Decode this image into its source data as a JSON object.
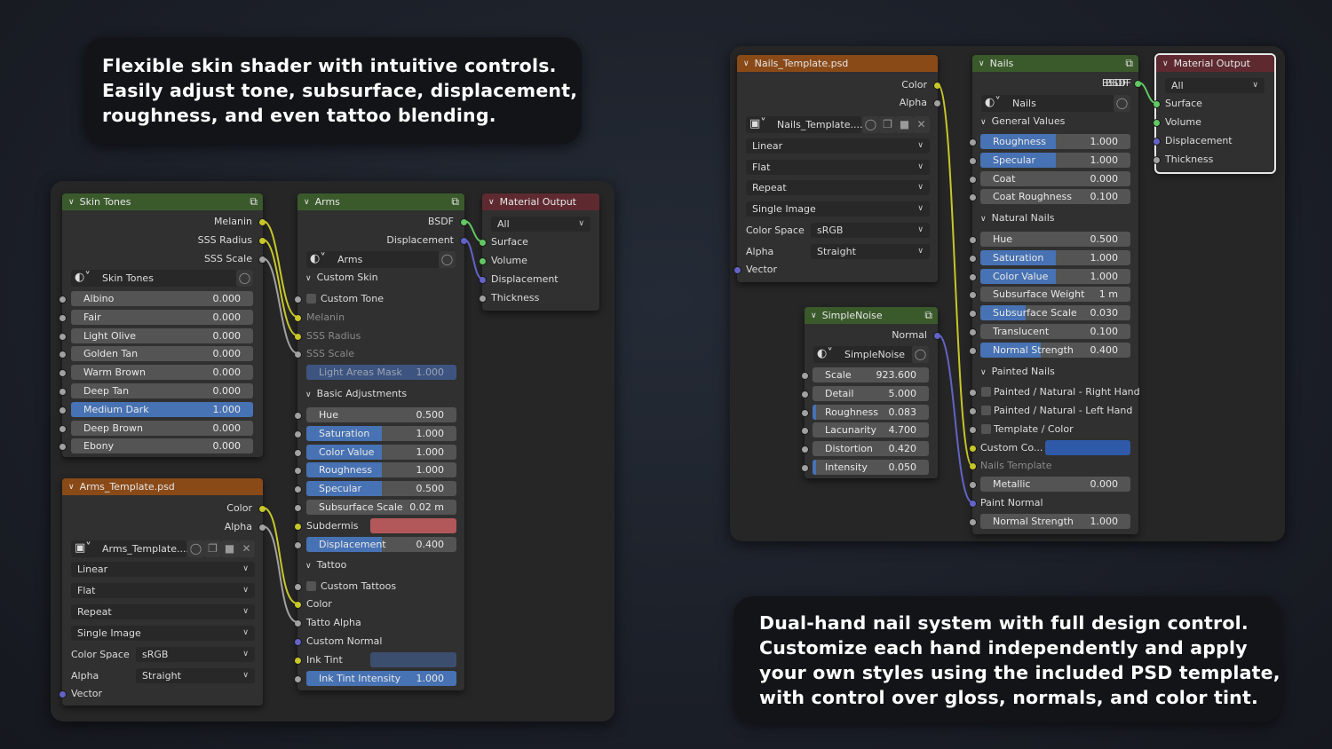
{
  "captions": {
    "top": [
      "Flexible skin shader with intuitive controls.",
      "Easily adjust tone, subsurface, displacement,",
      "roughness, and even tattoo blending."
    ],
    "bottom": [
      "Dual-hand nail system with full design control.",
      "Customize each hand independently and apply",
      "your own styles using the included PSD template,",
      "with control over gloss, normals, and color tint."
    ]
  },
  "colors": {
    "group_header": "#3b5a2c",
    "image_header": "#8a4a18",
    "output_header": "#5e2a30",
    "slider_fill": "#4772b3",
    "subdermis": "#b3585a",
    "ink_tint": "#3c4e6e",
    "custom_color": "#2f5aa8"
  },
  "skin_tones": {
    "title": "Skin Tones",
    "outputs": [
      "Melanin",
      "SSS Radius",
      "SSS Scale"
    ],
    "datablock": "Skin Tones",
    "sliders": [
      {
        "label": "Albino",
        "value": "0.000",
        "fill": 0
      },
      {
        "label": "Fair",
        "value": "0.000",
        "fill": 0
      },
      {
        "label": "Light Olive",
        "value": "0.000",
        "fill": 0
      },
      {
        "label": "Golden Tan",
        "value": "0.000",
        "fill": 0
      },
      {
        "label": "Warm Brown",
        "value": "0.000",
        "fill": 0
      },
      {
        "label": "Deep Tan",
        "value": "0.000",
        "fill": 0
      },
      {
        "label": "Medium Dark",
        "value": "1.000",
        "fill": 1
      },
      {
        "label": "Deep Brown",
        "value": "0.000",
        "fill": 0
      },
      {
        "label": "Ebony",
        "value": "0.000",
        "fill": 0
      }
    ]
  },
  "arms_image": {
    "title": "Arms_Template.psd",
    "outputs": [
      "Color",
      "Alpha"
    ],
    "datablock": "Arms_Template....",
    "interpolation": "Linear",
    "projection": "Flat",
    "extension": "Repeat",
    "source": "Single Image",
    "color_space_label": "Color Space",
    "color_space": "sRGB",
    "alpha_label": "Alpha",
    "alpha_mode": "Straight",
    "vector_label": "Vector"
  },
  "arms": {
    "title": "Arms",
    "outputs": [
      "BSDF",
      "Displacement"
    ],
    "datablock": "Arms",
    "section_skin": "Custom Skin",
    "custom_tone": "Custom Tone",
    "skin_inputs": [
      "Melanin",
      "SSS Radius",
      "SSS Scale"
    ],
    "light_areas": {
      "label": "Light Areas Mask",
      "value": "1.000",
      "fill": 1
    },
    "section_basic": "Basic Adjustments",
    "basic_sliders": [
      {
        "label": "Hue",
        "value": "0.500",
        "fill": 0
      },
      {
        "label": "Saturation",
        "value": "1.000",
        "fill": 0.5
      },
      {
        "label": "Color Value",
        "value": "1.000",
        "fill": 0.5
      },
      {
        "label": "Roughness",
        "value": "1.000",
        "fill": 0.5
      },
      {
        "label": "Specular",
        "value": "0.500",
        "fill": 0.5
      },
      {
        "label": "Subsurface Scale",
        "value": "0.02 m",
        "fill": 0
      }
    ],
    "subdermis": "Subdermis",
    "displacement": {
      "label": "Displacement",
      "value": "0.400",
      "fill": 0.5
    },
    "section_tattoo": "Tattoo",
    "custom_tattoos": "Custom Tattoos",
    "tattoo_color": "Color",
    "tattoo_alpha": "Tatto Alpha",
    "custom_normal": "Custom Normal",
    "ink_tint": "Ink Tint",
    "ink_intensity": {
      "label": "Ink Tint Intensity",
      "value": "1.000",
      "fill": 1
    }
  },
  "output_left": {
    "title": "Material Output",
    "target": "All",
    "inputs": [
      "Surface",
      "Volume",
      "Displacement",
      "Thickness"
    ]
  },
  "nails_image": {
    "title": "Nails_Template.psd",
    "outputs": [
      "Color",
      "Alpha"
    ],
    "datablock": "Nails_Template....",
    "interpolation": "Linear",
    "projection": "Flat",
    "extension": "Repeat",
    "source": "Single Image",
    "color_space_label": "Color Space",
    "color_space": "sRGB",
    "alpha_label": "Alpha",
    "alpha_mode": "Straight",
    "vector_label": "Vector"
  },
  "noise": {
    "title": "SimpleNoise",
    "output": "Normal",
    "datablock": "SimpleNoise",
    "sliders": [
      {
        "label": "Scale",
        "value": "923.600",
        "fill": 0
      },
      {
        "label": "Detail",
        "value": "5.000",
        "fill": 0
      },
      {
        "label": "Roughness",
        "value": "0.083",
        "fill": 0.03
      },
      {
        "label": "Lacunarity",
        "value": "4.700",
        "fill": 0
      },
      {
        "label": "Distortion",
        "value": "0.420",
        "fill": 0
      },
      {
        "label": "Intensity",
        "value": "0.050",
        "fill": 0.03
      }
    ]
  },
  "nails": {
    "title": "Nails",
    "output": "BSDF",
    "datablock": "Nails",
    "section_general": "General Values",
    "general": [
      {
        "label": "Roughness",
        "value": "1.000",
        "fill": 0.5
      },
      {
        "label": "Specular",
        "value": "1.000",
        "fill": 0.5
      },
      {
        "label": "Coat",
        "value": "0.000",
        "fill": 0
      },
      {
        "label": "Coat Roughness",
        "value": "0.100",
        "fill": 0
      }
    ],
    "section_natural": "Natural Nails",
    "natural": [
      {
        "label": "Hue",
        "value": "0.500",
        "fill": 0
      },
      {
        "label": "Saturation",
        "value": "1.000",
        "fill": 0.5
      },
      {
        "label": "Color Value",
        "value": "1.000",
        "fill": 0.5
      },
      {
        "label": "Subsurface Weight",
        "value": "1 m",
        "fill": 0
      },
      {
        "label": "Subsurface Scale",
        "value": "0.030",
        "fill": 0.3
      },
      {
        "label": "Translucent",
        "value": "0.100",
        "fill": 0
      },
      {
        "label": "Normal Strength",
        "value": "0.400",
        "fill": 0.4
      }
    ],
    "section_painted": "Painted Nails",
    "painted_right": "Painted / Natural  - Right Hand",
    "painted_left": "Painted / Natural  - Left Hand",
    "template_color": "Template / Color",
    "custom_color": "Custom Co...",
    "nails_template": "Nails Template",
    "metallic": {
      "label": "Metallic",
      "value": "0.000",
      "fill": 0
    },
    "paint_normal": "Paint Normal",
    "normal_strength": {
      "label": "Normal Strength",
      "value": "1.000",
      "fill": 0
    }
  },
  "output_right": {
    "title": "Material Output",
    "input_bsdf": "BSDF",
    "target": "All",
    "inputs": [
      "Surface",
      "Volume",
      "Displacement",
      "Thickness"
    ]
  }
}
